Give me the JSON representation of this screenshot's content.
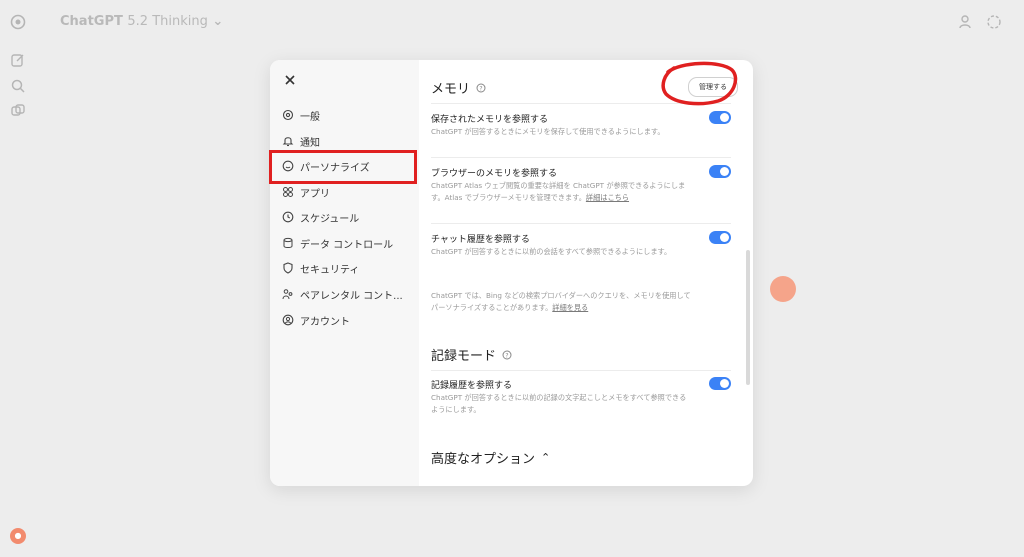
{
  "app": {
    "name": "ChatGPT",
    "model": "5.2 Thinking"
  },
  "settings": {
    "nav": [
      {
        "label": "一般",
        "icon": "gear-icon"
      },
      {
        "label": "通知",
        "icon": "bell-icon"
      },
      {
        "label": "パーソナライズ",
        "icon": "personalize-icon",
        "selected": true
      },
      {
        "label": "アプリ",
        "icon": "apps-icon"
      },
      {
        "label": "スケジュール",
        "icon": "clock-icon"
      },
      {
        "label": "データ コントロール",
        "icon": "database-icon"
      },
      {
        "label": "セキュリティ",
        "icon": "shield-icon"
      },
      {
        "label": "ペアレンタル コント...",
        "icon": "parental-icon"
      },
      {
        "label": "アカウント",
        "icon": "account-icon"
      }
    ],
    "memory": {
      "title": "メモリ",
      "manage_label": "管理する",
      "saved": {
        "title": "保存されたメモリを参照する",
        "desc": "ChatGPT が回答するときにメモリを保存して使用できるようにします。",
        "enabled": true
      },
      "browser": {
        "title": "ブラウザーのメモリを参照する",
        "desc": "ChatGPT Atlas ウェブ閲覧の重要な詳細を ChatGPT が参照できるようにします。Atlas でブラウザーメモリを管理できます。",
        "link": "詳細はこちら",
        "enabled": true
      },
      "chat_history": {
        "title": "チャット履歴を参照する",
        "desc": "ChatGPT が回答するときに以前の会話をすべて参照できるようにします。",
        "enabled": true
      },
      "note": {
        "desc": "ChatGPT では、Bing などの検索プロバイダーへのクエリを、メモリを使用してパーソナライズすることがあります。",
        "link": "詳細を見る"
      }
    },
    "record_mode": {
      "title": "記録モード",
      "history": {
        "title": "記録履歴を参照する",
        "desc": "ChatGPT が回答するときに以前の記録の文字起こしとメモをすべて参照できるようにします。",
        "enabled": true
      }
    },
    "advanced": {
      "title": "高度なオプション",
      "chevron": "chevron-up-icon"
    }
  },
  "colors": {
    "toggle_on": "#3b82f6",
    "annotation_red": "#e02020",
    "modal_nav_bg": "#f7f7f7"
  }
}
